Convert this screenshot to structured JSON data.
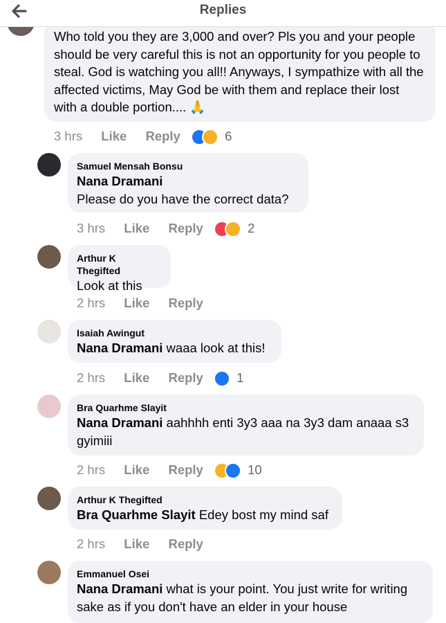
{
  "header": {
    "title": "Replies"
  },
  "root_comment": {
    "text": "Who told you they are 3,000 and over? Pls you and your people should be very careful this is not an opportunity for you people to steal. God is watching you all!!  Anyways, I sympathize with all the affected victims, May God be with them and replace their lost with a double portion.... 🙏",
    "time": "3 hrs",
    "like_label": "Like",
    "reply_label": "Reply",
    "reaction_count": "6",
    "reactions": [
      "like",
      "haha"
    ]
  },
  "replies": [
    {
      "author": "Samuel Mensah Bonsu",
      "mention": "Nana Dramani",
      "text": "Please do you have the correct data?",
      "time": "3 hrs",
      "like_label": "Like",
      "reply_label": "Reply",
      "reaction_count": "2",
      "reactions": [
        "love",
        "haha"
      ]
    },
    {
      "author": "Arthur K Thegifted",
      "mention": "",
      "text": "Look at this",
      "time": "2 hrs",
      "like_label": "Like",
      "reply_label": "Reply",
      "reaction_count": "",
      "reactions": []
    },
    {
      "author": "Isaiah Awingut",
      "mention": "Nana Dramani",
      "text": " waaa look at this!",
      "time": "2 hrs",
      "like_label": "Like",
      "reply_label": "Reply",
      "reaction_count": "1",
      "reactions": [
        "like"
      ]
    },
    {
      "author": "Bra Quarhme Slayit",
      "mention": "Nana Dramani",
      "text": " aahhhh enti 3y3 aaa na 3y3 dam anaaa s3 gyimiii",
      "time": "2 hrs",
      "like_label": "Like",
      "reply_label": "Reply",
      "reaction_count": "10",
      "reactions": [
        "haha",
        "like"
      ]
    },
    {
      "author": "Arthur K Thegifted",
      "mention": "Bra Quarhme Slayit",
      "text": " Edey bost my mind saf",
      "time": "2 hrs",
      "like_label": "Like",
      "reply_label": "Reply",
      "reaction_count": "",
      "reactions": []
    },
    {
      "author": "Emmanuel Osei",
      "mention": "Nana Dramani",
      "text": " what is your point. You just write for writing sake as if you don't have an elder in your house",
      "time": "",
      "like_label": "",
      "reply_label": "",
      "reaction_count": "",
      "reactions": []
    }
  ],
  "colors": {
    "bubble": "#f0f2f5",
    "like": "#1877f2",
    "love": "#f33e58",
    "haha": "#f7b125",
    "muted": "#65676b"
  },
  "icons": {
    "back": "arrow-left-icon"
  }
}
